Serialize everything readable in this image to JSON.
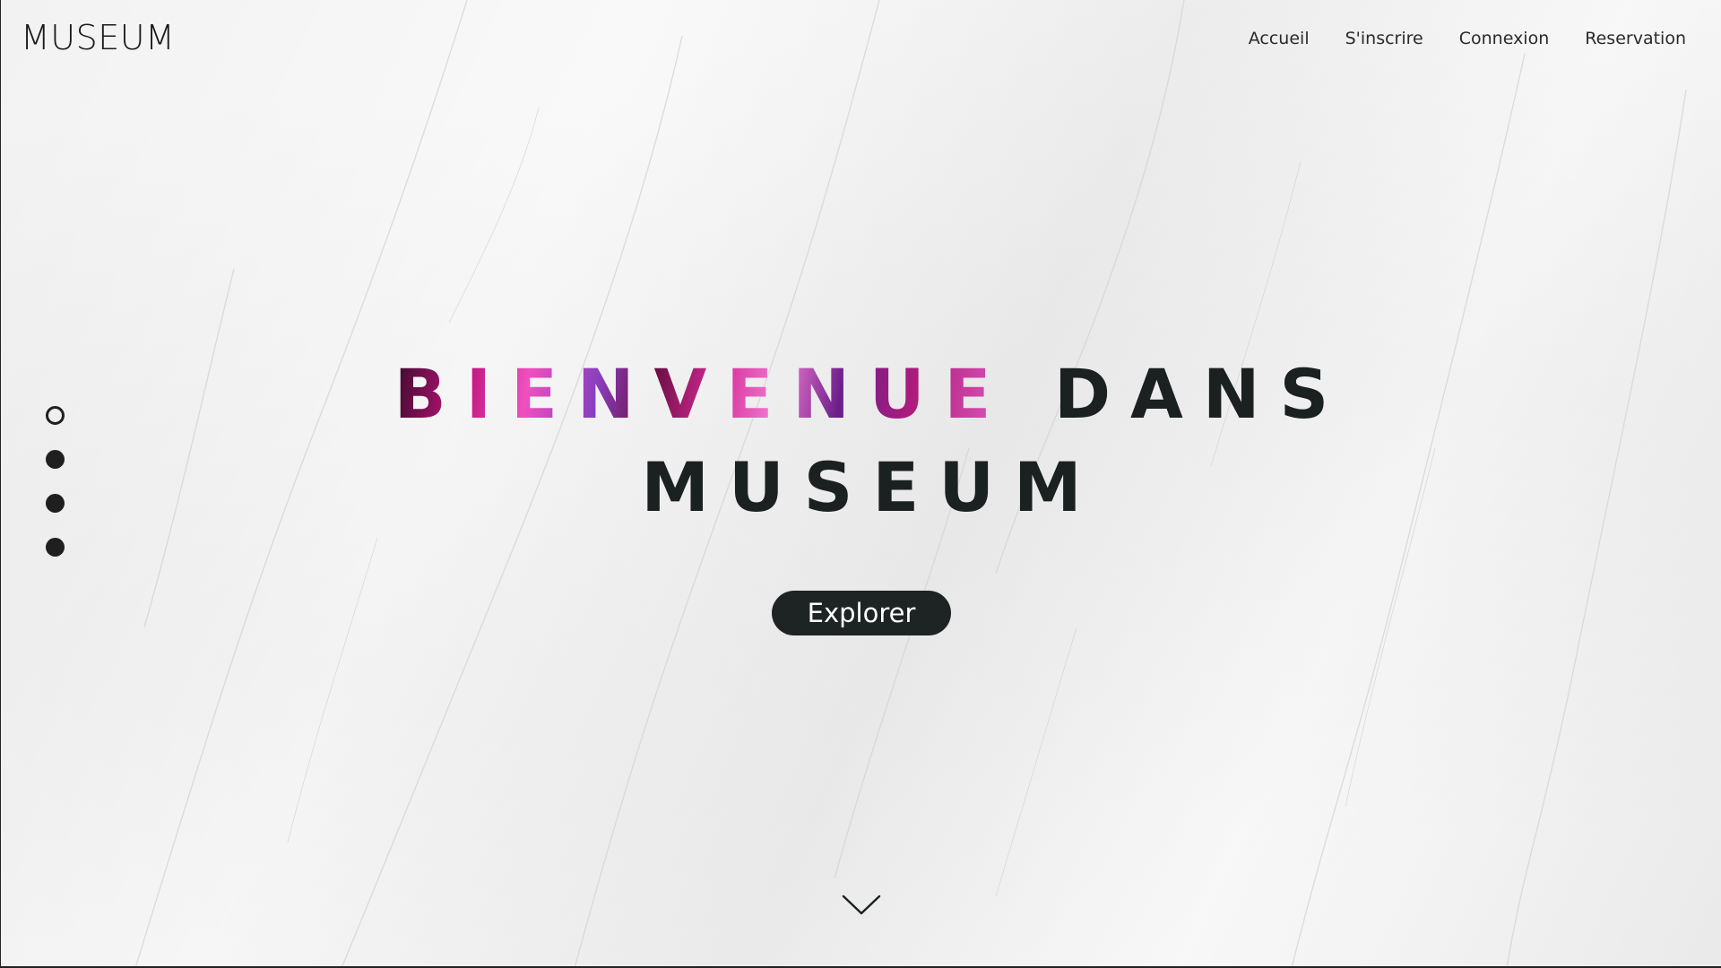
{
  "header": {
    "logo": "MUSEUM",
    "nav": [
      {
        "label": "Accueil"
      },
      {
        "label": "S'inscrire"
      },
      {
        "label": "Connexion"
      },
      {
        "label": "Reservation"
      }
    ]
  },
  "slider": {
    "count": 4,
    "active_index": 0
  },
  "hero": {
    "highlight_word": "BIENVENUE",
    "line1_rest": "DANS",
    "line2": "MUSEUM",
    "explore_button": "Explorer"
  },
  "icons": {
    "scroll": "chevron-down-icon"
  },
  "colors": {
    "text_dark": "#1b2020",
    "button_bg": "#1e2424",
    "button_text": "#ffffff",
    "background": "#f2f2f2",
    "accent_gradient": [
      "#c0157e",
      "#8a3fbf",
      "#f07ad0"
    ]
  }
}
